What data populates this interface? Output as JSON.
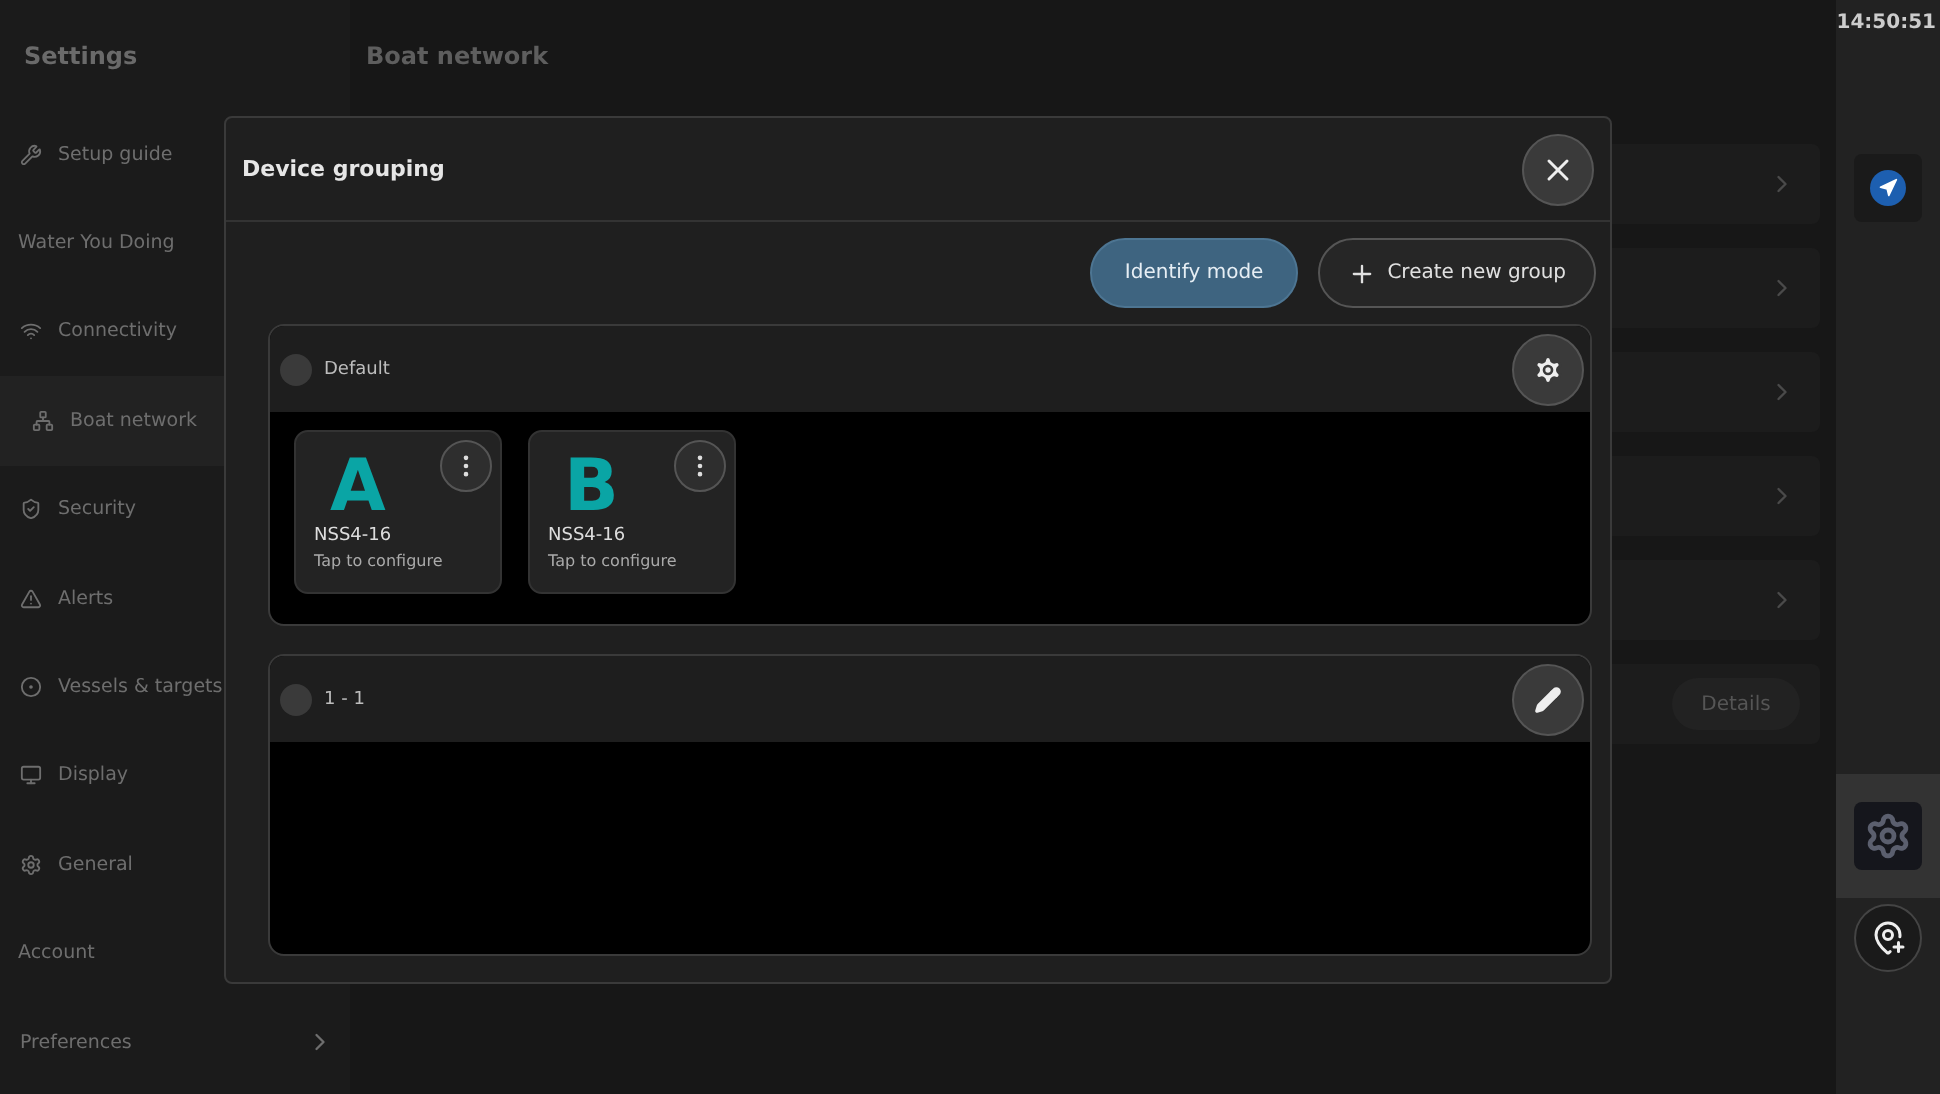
{
  "sidebar": {
    "title": "Settings",
    "items": [
      {
        "label": "Setup guide",
        "kind": "item",
        "selected": false
      },
      {
        "label": "Water You Doing",
        "kind": "header"
      },
      {
        "label": "Connectivity",
        "kind": "item",
        "selected": false
      },
      {
        "label": "Boat network",
        "kind": "item",
        "selected": true
      },
      {
        "label": "Security",
        "kind": "item",
        "selected": false
      },
      {
        "label": "Alerts",
        "kind": "item",
        "selected": false
      },
      {
        "label": "Vessels & targets",
        "kind": "item",
        "selected": false
      },
      {
        "label": "Display",
        "kind": "item",
        "selected": false
      },
      {
        "label": "General",
        "kind": "item",
        "selected": false
      },
      {
        "label": "Account",
        "kind": "header"
      },
      {
        "label": "Preferences",
        "kind": "expand",
        "selected": false
      }
    ]
  },
  "main": {
    "title": "Boat network",
    "rows": [
      {
        "kind": "chevron"
      },
      {
        "kind": "chevron"
      },
      {
        "kind": "chevron"
      },
      {
        "kind": "chevron"
      },
      {
        "kind": "chevron"
      },
      {
        "kind": "button",
        "button": "Details"
      }
    ]
  },
  "rail": {
    "time": "14:50:51",
    "items": [
      {
        "selected": false
      },
      {
        "selected": true
      },
      {
        "selected": false
      }
    ]
  },
  "dialog": {
    "title": "Device grouping",
    "actions": [
      {
        "label": "Identify mode",
        "kind": "primary"
      },
      {
        "label": "Create new group",
        "kind": "outline"
      }
    ],
    "groups": [
      {
        "name": "Default",
        "devices": [
          {
            "letter": "A",
            "model": "NSS4-16",
            "hint": "Tap to configure"
          },
          {
            "letter": "B",
            "model": "NSS4-16",
            "hint": "Tap to configure"
          }
        ]
      },
      {
        "name": "1 - 1"
      }
    ]
  }
}
